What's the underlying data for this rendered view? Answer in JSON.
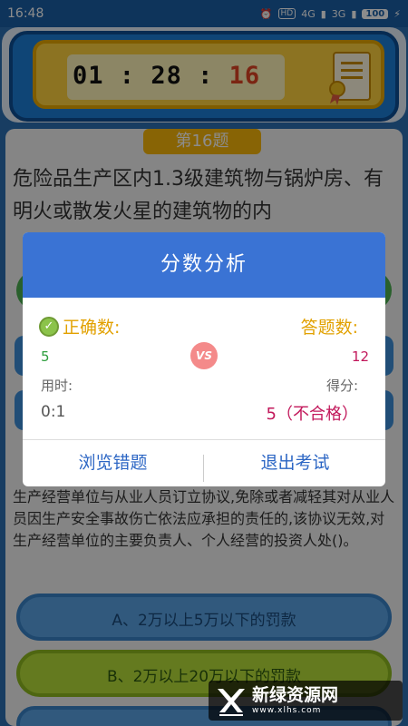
{
  "status_bar": {
    "time": "16:48",
    "network1": "4G",
    "network2": "3G",
    "battery": "100"
  },
  "timer": {
    "hours": "01",
    "minutes": "28",
    "seconds": "16",
    "sep": ":"
  },
  "question": {
    "number_label": "第16题",
    "text": "危险品生产区内1.3级建筑物与锅炉房、有明火或散发火星的建筑物的内"
  },
  "question2": {
    "text": "生产经营单位与从业人员订立协议,免除或者减轻其对从业人员因生产安全事故伤亡依法应承担的责任的,该协议无效,对生产经营单位的主要负责人、个人经营的投资人处()。",
    "options": [
      "A、2万以上5万以下的罚款",
      "B、2万以上20万以下的罚款"
    ]
  },
  "dialog": {
    "title": "分数分析",
    "correct_label": "正确数:",
    "correct_count": "5",
    "answered_label": "答题数:",
    "answered_count": "12",
    "vs": "VS",
    "time_label": "用时:",
    "time_value": "0:1",
    "score_label": "得分:",
    "score_value": "5（不合格）",
    "review_button": "浏览错题",
    "exit_button": "退出考试"
  },
  "watermark": {
    "name": "新绿资源网",
    "url": "www.xlhs.com"
  },
  "colors": {
    "accent": "#3a73d4",
    "correct": "#2e9e3e",
    "fail": "#c2185b",
    "label": "#e2a100"
  }
}
